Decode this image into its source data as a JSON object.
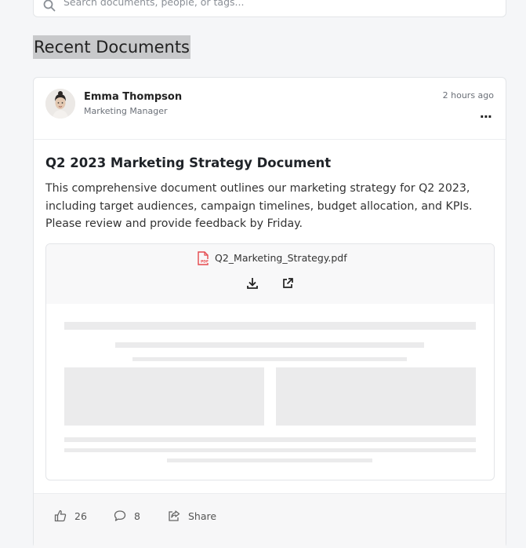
{
  "search": {
    "placeholder": "Search documents, people, or tags..."
  },
  "section": {
    "title": "Recent Documents"
  },
  "post": {
    "author": {
      "name": "Emma Thompson",
      "role": "Marketing Manager"
    },
    "timestamp": "2 hours ago",
    "more_label": "...",
    "title": "Q2 2023 Marketing Strategy Document",
    "description": "This comprehensive document outlines our marketing strategy for Q2 2023, including target audiences, campaign timelines, budget allocation, and KPIs. Please review and provide feedback by Friday.",
    "attachment": {
      "file_name": "Q2_Marketing_Strategy.pdf",
      "icon": "pdf-icon"
    },
    "actions": {
      "likes": "26",
      "comments": "8",
      "share_label": "Share"
    }
  },
  "colors": {
    "highlight": "#c8c9cb",
    "pdf_red": "#e5484d",
    "placeholder_bar": "#ebebec"
  }
}
